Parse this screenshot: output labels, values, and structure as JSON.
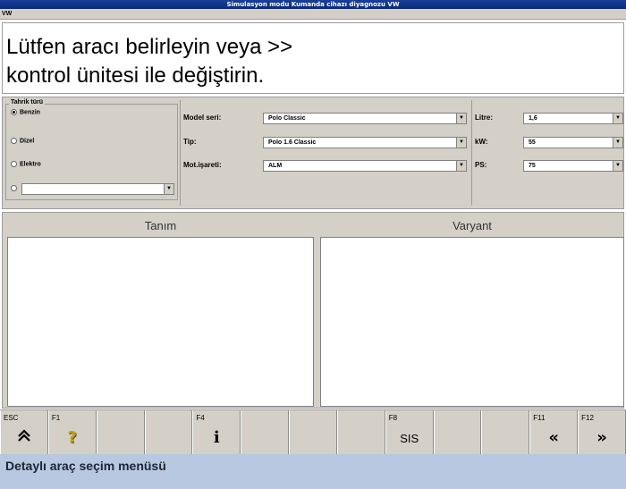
{
  "window": {
    "title": "Simulasyon modu Kumanda cihazı diyagnozu VW",
    "subtitle": "VW"
  },
  "prompt": {
    "line1": "Lütfen aracı belirleyin veya >>",
    "line2": "kontrol ünitesi ile değiştirin."
  },
  "drive_type": {
    "title": "Tahrik türü",
    "options": [
      {
        "label": "Benzin",
        "selected": true
      },
      {
        "label": "Dizel",
        "selected": false
      },
      {
        "label": "Elektro",
        "selected": false
      },
      {
        "label": "",
        "selected": false
      }
    ],
    "custom_value": ""
  },
  "fields": {
    "model_label": "Model seri:",
    "model_value": "Polo Classic",
    "type_label": "Tip:",
    "type_value": "Polo 1.6 Classic",
    "engine_label": "Mot.işareti:",
    "engine_value": "ALM",
    "litre_label": "Litre:",
    "litre_value": "1,6",
    "kw_label": "kW:",
    "kw_value": "55",
    "ps_label": "PS:",
    "ps_value": "75"
  },
  "table": {
    "col1": "Tanım",
    "col2": "Varyant"
  },
  "fkeys": [
    {
      "key": "ESC",
      "icon": "double-up-arrow",
      "glyph": "⌃"
    },
    {
      "key": "F1",
      "icon": "help-icon",
      "glyph": "?"
    },
    {
      "key": "",
      "icon": "",
      "glyph": ""
    },
    {
      "key": "",
      "icon": "",
      "glyph": ""
    },
    {
      "key": "F4",
      "icon": "info-icon",
      "glyph": "i"
    },
    {
      "key": "",
      "icon": "",
      "glyph": ""
    },
    {
      "key": "",
      "icon": "",
      "glyph": ""
    },
    {
      "key": "",
      "icon": "",
      "glyph": ""
    },
    {
      "key": "F8",
      "icon": "sis-text",
      "glyph": "SIS"
    },
    {
      "key": "",
      "icon": "",
      "glyph": ""
    },
    {
      "key": "",
      "icon": "",
      "glyph": ""
    },
    {
      "key": "F11",
      "icon": "back-arrows",
      "glyph": "«"
    },
    {
      "key": "F12",
      "icon": "forward-arrows",
      "glyph": "»"
    }
  ],
  "footer": {
    "caption": "Detaylı araç seçim menüsü"
  }
}
